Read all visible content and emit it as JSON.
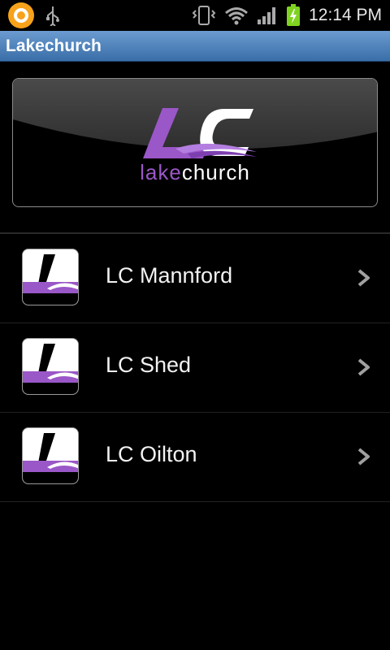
{
  "status_bar": {
    "time": "12:14 PM",
    "icons": [
      "notification-app-icon",
      "usb-icon",
      "vibrate-icon",
      "wifi-icon",
      "signal-icon",
      "battery-charging-icon"
    ]
  },
  "app": {
    "title": "Lakechurch"
  },
  "banner": {
    "logo_letters": "LC",
    "brand_part1": "lake",
    "brand_part2": "church",
    "accent_color": "#9a57c7"
  },
  "locations": [
    {
      "label": "LC Mannford",
      "icon": "chevron-right-icon"
    },
    {
      "label": "LC Shed",
      "icon": "chevron-right-icon"
    },
    {
      "label": "LC Oilton",
      "icon": "chevron-right-icon"
    }
  ]
}
